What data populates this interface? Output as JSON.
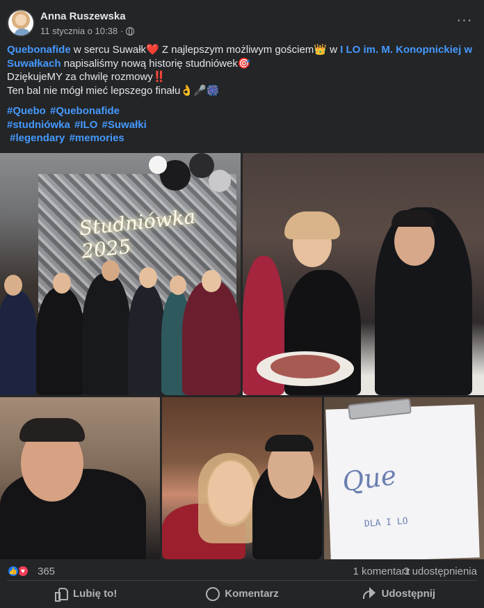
{
  "post": {
    "author": "Anna Ruszewska",
    "timestamp": "11 stycznia o 10:38",
    "audience_icon": "globe-icon",
    "more_icon": "more-icon",
    "text": {
      "line1_link1": "Quebonafide",
      "line1_part1": " w sercu Suwałk",
      "line1_emoji1": "❤️",
      "line1_part2": " Z najlepszym możliwym gościem",
      "line1_emoji2": "👑",
      "line1_part3": " w ",
      "line1_link2": "I LO im. M. Konopnickiej w Suwałkach",
      "line1_part4": " napisaliśmy nową historię studniówek",
      "line1_emoji3": "🎯",
      "line2": "DziękujeMY za chwilę rozmowy",
      "line2_emoji": "‼️",
      "line3": "Ten bal nie mógł mieć lepszego finału",
      "line3_emoji": "👌🎤🎆"
    },
    "hashtags": {
      "row1": [
        "#Quebo",
        "#Quebonafide"
      ],
      "row2": [
        "#studniówka",
        "#ILO",
        "#Suwałki"
      ],
      "row3": [
        "#legendary",
        "#memories"
      ]
    },
    "photos": {
      "photo1_sign": "Studniówka 2025",
      "photo5_scribble": "Que",
      "photo5_scribble2": "DLA I LO"
    }
  },
  "engagement": {
    "reaction_icons": [
      "like-icon",
      "love-icon"
    ],
    "reaction_count": "365",
    "comments": "1 komentarz",
    "shares": "3 udostępnienia"
  },
  "actions": {
    "like": "Lubię to!",
    "comment": "Komentarz",
    "share": "Udostępnij"
  },
  "colors": {
    "background": "#242526",
    "text": "#e4e6eb",
    "secondary_text": "#b0b3b8",
    "link": "#4599ff",
    "like": "#1877f2",
    "love": "#f33e58"
  }
}
